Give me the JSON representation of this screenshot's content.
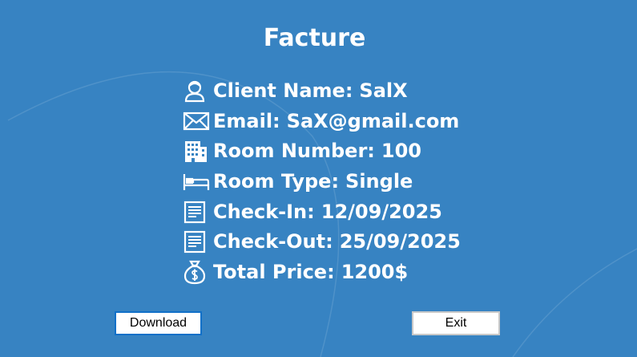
{
  "title": "Facture",
  "fields": [
    {
      "icon": "user-icon",
      "label": "Client Name:",
      "value": "SalX"
    },
    {
      "icon": "envelope-icon",
      "label": "Email:",
      "value": "SaX@gmail.com"
    },
    {
      "icon": "building-icon",
      "label": "Room Number:",
      "value": "100"
    },
    {
      "icon": "bed-icon",
      "label": "Room Type:",
      "value": "Single"
    },
    {
      "icon": "document-icon",
      "label": "Check-In:",
      "value": "12/09/2025"
    },
    {
      "icon": "document-icon",
      "label": "Check-Out:",
      "value": "25/09/2025"
    },
    {
      "icon": "money-bag-icon",
      "label": "Total Price:",
      "value": "1200$"
    }
  ],
  "buttons": {
    "download_label": "Download",
    "exit_label": "Exit"
  },
  "colors": {
    "background": "#3783c2",
    "text": "#ffffff",
    "download_border": "#1170c8"
  }
}
